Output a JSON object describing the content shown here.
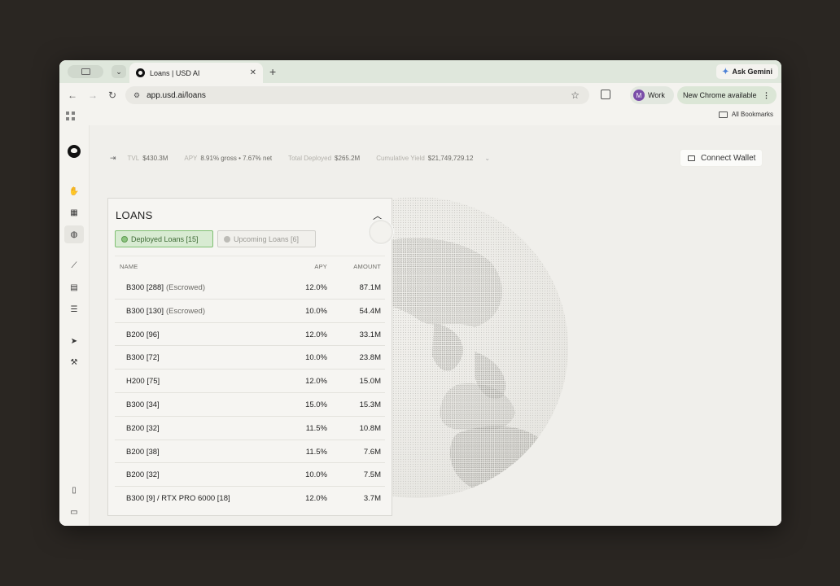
{
  "browser": {
    "tab_title": "Loans | USD AI",
    "new_tab_icon": "plus-icon",
    "gemini_label": "Ask Gemini",
    "url": "app.usd.ai/loans",
    "profile_initial": "M",
    "profile_name": "Work",
    "update_label": "New Chrome available",
    "bookmarks_label": "All Bookmarks"
  },
  "stats": {
    "tvl_label": "TVL",
    "tvl_value": "$430.3M",
    "apy_label": "APY",
    "apy_value": "8.91% gross • 7.67% net",
    "deployed_label": "Total Deployed",
    "deployed_value": "$265.2M",
    "yield_label": "Cumulative Yield",
    "yield_value": "$21,749,729.12"
  },
  "connect_wallet": "Connect Wallet",
  "loans": {
    "title": "LOANS",
    "tabs": [
      {
        "label": "Deployed Loans [15]",
        "active": true
      },
      {
        "label": "Upcoming Loans [6]",
        "active": false
      }
    ],
    "columns": {
      "name": "NAME",
      "apy": "APY",
      "amount": "AMOUNT"
    },
    "rows": [
      {
        "name": "B300 [288]",
        "note": "(Escrowed)",
        "apy": "12.0%",
        "amount": "87.1M"
      },
      {
        "name": "B300 [130]",
        "note": "(Escrowed)",
        "apy": "10.0%",
        "amount": "54.4M"
      },
      {
        "name": "B200 [96]",
        "note": "",
        "apy": "12.0%",
        "amount": "33.1M"
      },
      {
        "name": "B300 [72]",
        "note": "",
        "apy": "10.0%",
        "amount": "23.8M"
      },
      {
        "name": "H200 [75]",
        "note": "",
        "apy": "12.0%",
        "amount": "15.0M"
      },
      {
        "name": "B300 [34]",
        "note": "",
        "apy": "15.0%",
        "amount": "15.3M"
      },
      {
        "name": "B200 [32]",
        "note": "",
        "apy": "11.5%",
        "amount": "10.8M"
      },
      {
        "name": "B200 [38]",
        "note": "",
        "apy": "11.5%",
        "amount": "7.6M"
      },
      {
        "name": "B200 [32]",
        "note": "",
        "apy": "10.0%",
        "amount": "7.5M"
      },
      {
        "name": "B300 [9] / RTX PRO 6000 [18]",
        "note": "",
        "apy": "12.0%",
        "amount": "3.7M"
      }
    ]
  },
  "colors": {
    "accent_green": "#7fbf72",
    "page_bg": "#f0efeb",
    "frame_bg": "#2a2622"
  }
}
